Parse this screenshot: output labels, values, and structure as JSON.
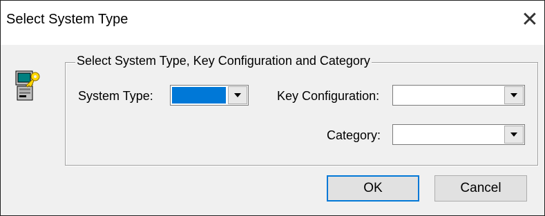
{
  "window": {
    "title": "Select System Type",
    "close_glyph": "✕"
  },
  "group": {
    "legend": "Select System Type, Key Configuration and Category"
  },
  "fields": {
    "system_type": {
      "label": "System Type:",
      "value": ""
    },
    "key_configuration": {
      "label": "Key Configuration:",
      "value": ""
    },
    "category": {
      "label": "Category:",
      "value": ""
    }
  },
  "buttons": {
    "ok": "OK",
    "cancel": "Cancel"
  },
  "icons": {
    "app": "computer-with-key-icon",
    "dropdown": "chevron-down-icon"
  },
  "colors": {
    "selection": "#0078d7",
    "dialog_bg": "#f0f0f0"
  }
}
